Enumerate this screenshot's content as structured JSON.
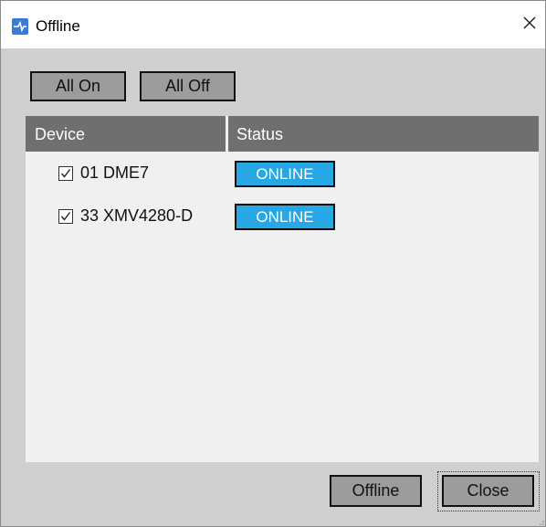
{
  "window": {
    "title": "Offline",
    "icon": "app-logo-icon",
    "close_icon": "close-icon"
  },
  "toolbar": {
    "all_on_label": "All On",
    "all_off_label": "All Off"
  },
  "table": {
    "columns": [
      "Device",
      "Status"
    ],
    "rows": [
      {
        "checked": true,
        "device": "01 DME7",
        "status": "ONLINE"
      },
      {
        "checked": true,
        "device": "33 XMV4280-D",
        "status": "ONLINE"
      }
    ]
  },
  "footer": {
    "offline_label": "Offline",
    "close_label": "Close"
  },
  "colors": {
    "status_online": "#27a7e3",
    "header_bg": "#6f6f6f",
    "button_bg": "#9c9c9c",
    "dialog_bg": "#cfcfcf"
  }
}
